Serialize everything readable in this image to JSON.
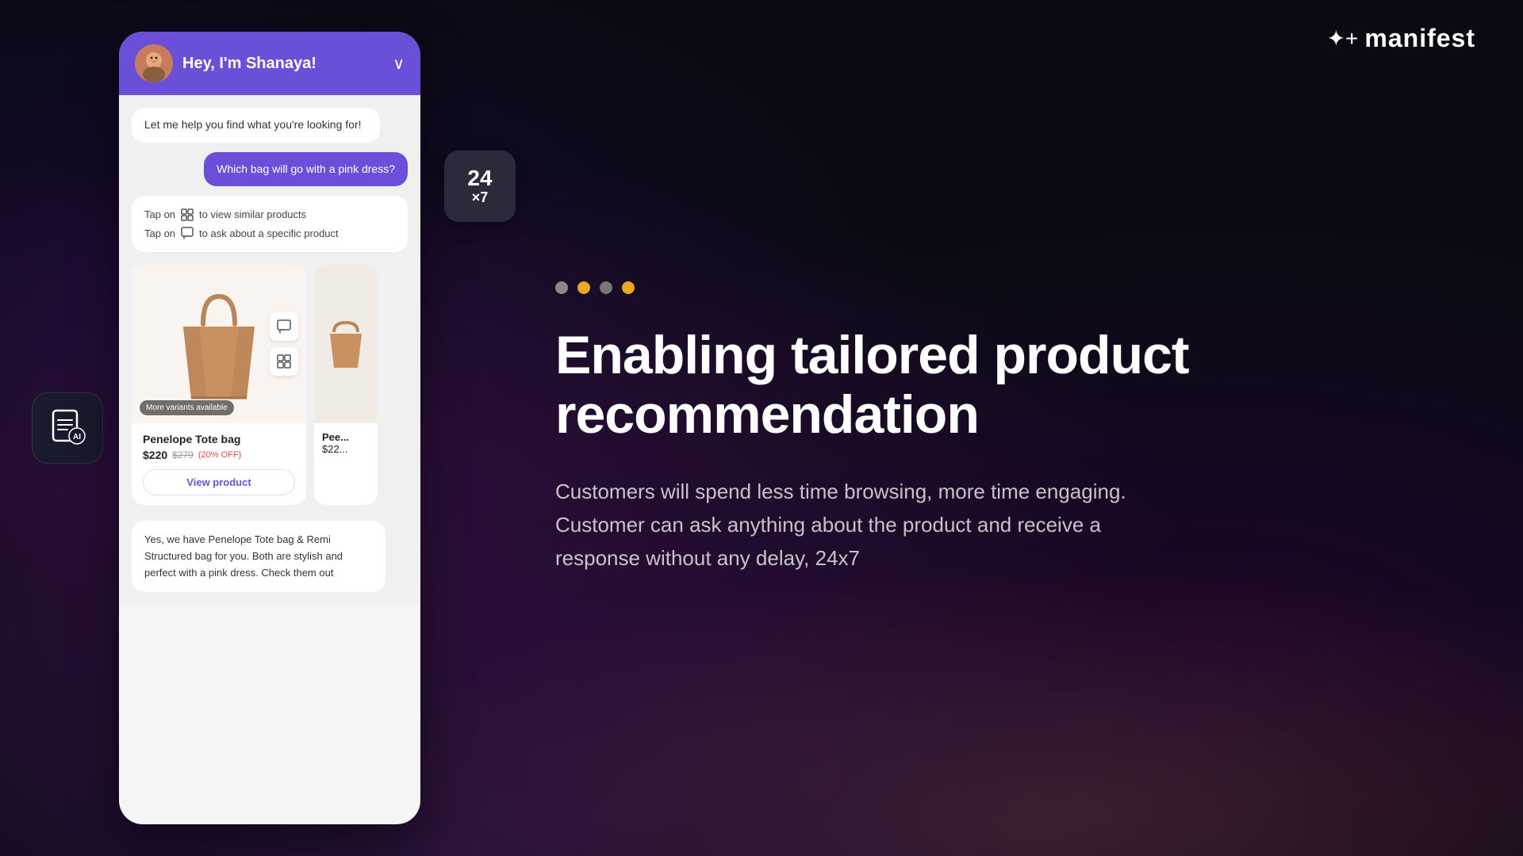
{
  "logo": {
    "star": "✦",
    "text": "manifest"
  },
  "chat": {
    "agent_name": "Hey, I'm Shanaya!",
    "greeting": "Let me help you find what you're looking for!",
    "user_message": "Which bag will go with a pink dress?",
    "tap_instructions": {
      "line1_prefix": "Tap on",
      "line1_icon": "⊞",
      "line1_suffix": "to view similar products",
      "line2_prefix": "Tap on",
      "line2_icon": "💬",
      "line2_suffix": "to ask about a specific product"
    },
    "reply_text": "Yes, we have Penelope Tote bag & Remi Structured bag for you. Both are stylish and perfect with a pink dress. Check them out"
  },
  "timer": {
    "number": "24",
    "sub": "×7"
  },
  "products": [
    {
      "name": "Penelope Tote bag",
      "price_current": "$220",
      "price_original": "$279",
      "discount": "(20% OFF)",
      "variants_label": "More variants available",
      "view_btn_label": "View product"
    },
    {
      "name": "Pee...",
      "price_current": "$22..."
    }
  ],
  "right": {
    "headline": "Enabling tailored product recommendation",
    "subtext": "Customers will spend less time browsing, more time engaging. Customer can ask anything about the product and receive a response without any delay, 24x7",
    "dots": [
      "gray",
      "yellow",
      "gray",
      "yellow"
    ]
  }
}
